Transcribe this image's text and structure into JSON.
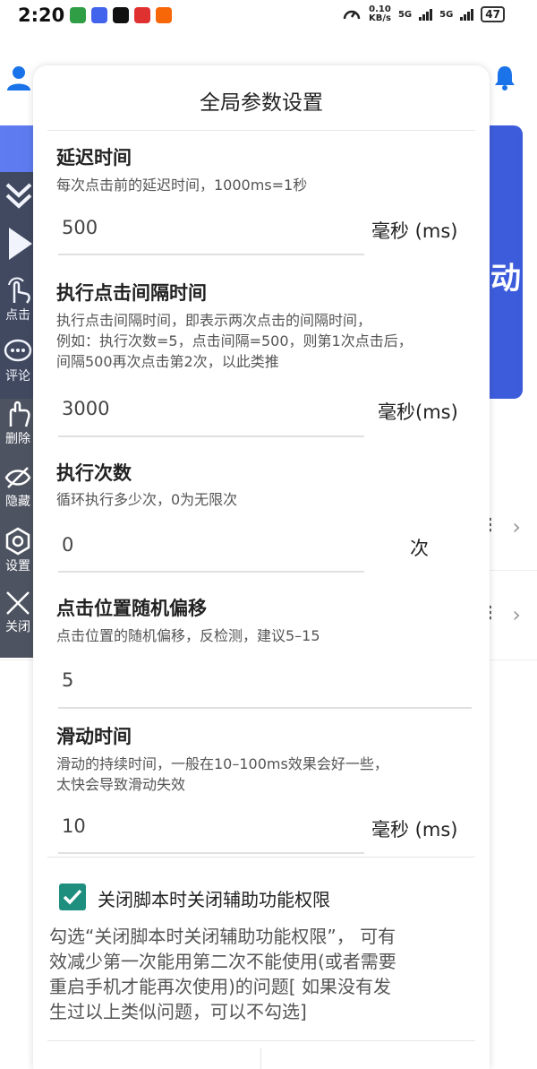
{
  "status": {
    "time": "2:20",
    "speed_value": "0.10",
    "speed_unit": "KB/s",
    "sig1": "5G",
    "sig2": "5G",
    "battery": "47"
  },
  "background": {
    "banner_text": "动"
  },
  "sidebar": {
    "items": [
      {
        "label": "",
        "icon": "chevrons-down-icon"
      },
      {
        "label": "",
        "icon": "play-icon"
      },
      {
        "label": "点击",
        "icon": "tap-hand-icon"
      },
      {
        "label": "评论",
        "icon": "comment-icon"
      },
      {
        "label": "删除",
        "icon": "hand-icon"
      },
      {
        "label": "隐藏",
        "icon": "eye-off-icon"
      },
      {
        "label": "设置",
        "icon": "gear-icon"
      },
      {
        "label": "关闭",
        "icon": "close-icon"
      }
    ]
  },
  "dialog": {
    "title": "全局参数设置",
    "delay": {
      "title": "延迟时间",
      "desc": "每次点击前的延迟时间，1000ms=1秒",
      "value": "500",
      "unit": "毫秒 (ms)"
    },
    "interval": {
      "title": "执行点击间隔时间",
      "desc1": "执行点击间隔时间，即表示两次点击的间隔时间，",
      "desc2": "例如：执行次数=5，点击间隔=500，则第1次点击后，",
      "desc3": "间隔500再次点击第2次，以此类推",
      "value": "3000",
      "unit": "毫秒(ms)"
    },
    "count": {
      "title": "执行次数",
      "desc": "循环执行多少次，0为无限次",
      "value": "0",
      "unit": "次"
    },
    "offset": {
      "title": "点击位置随机偏移",
      "desc": "点击位置的随机偏移，反检测，建议5–15",
      "value": "5"
    },
    "swipe": {
      "title": "滑动时间",
      "desc1": "滑动的持续时间，一般在10–100ms效果会好一些，",
      "desc2": "太快会导致滑动失效",
      "value": "10",
      "unit": "毫秒 (ms)"
    },
    "checkbox_label": "关闭脚本时关闭辅助功能权限",
    "checkbox_checked": true,
    "note1": "勾选“关闭脚本时关闭辅助功能权限”， 可有",
    "note2": "效减少第一次能用第二次不能使用(或者需要",
    "note3": "重启手机才能再次使用)的问题[ 如果没有发",
    "note4": "生过以上类似问题，可以不勾选]"
  },
  "colors": {
    "accent": "#1e8e7e",
    "banner": "#3b5bdb",
    "user_icon": "#1a73e8",
    "bell_icon": "#1a73e8",
    "sidebar": "#3e4553"
  }
}
